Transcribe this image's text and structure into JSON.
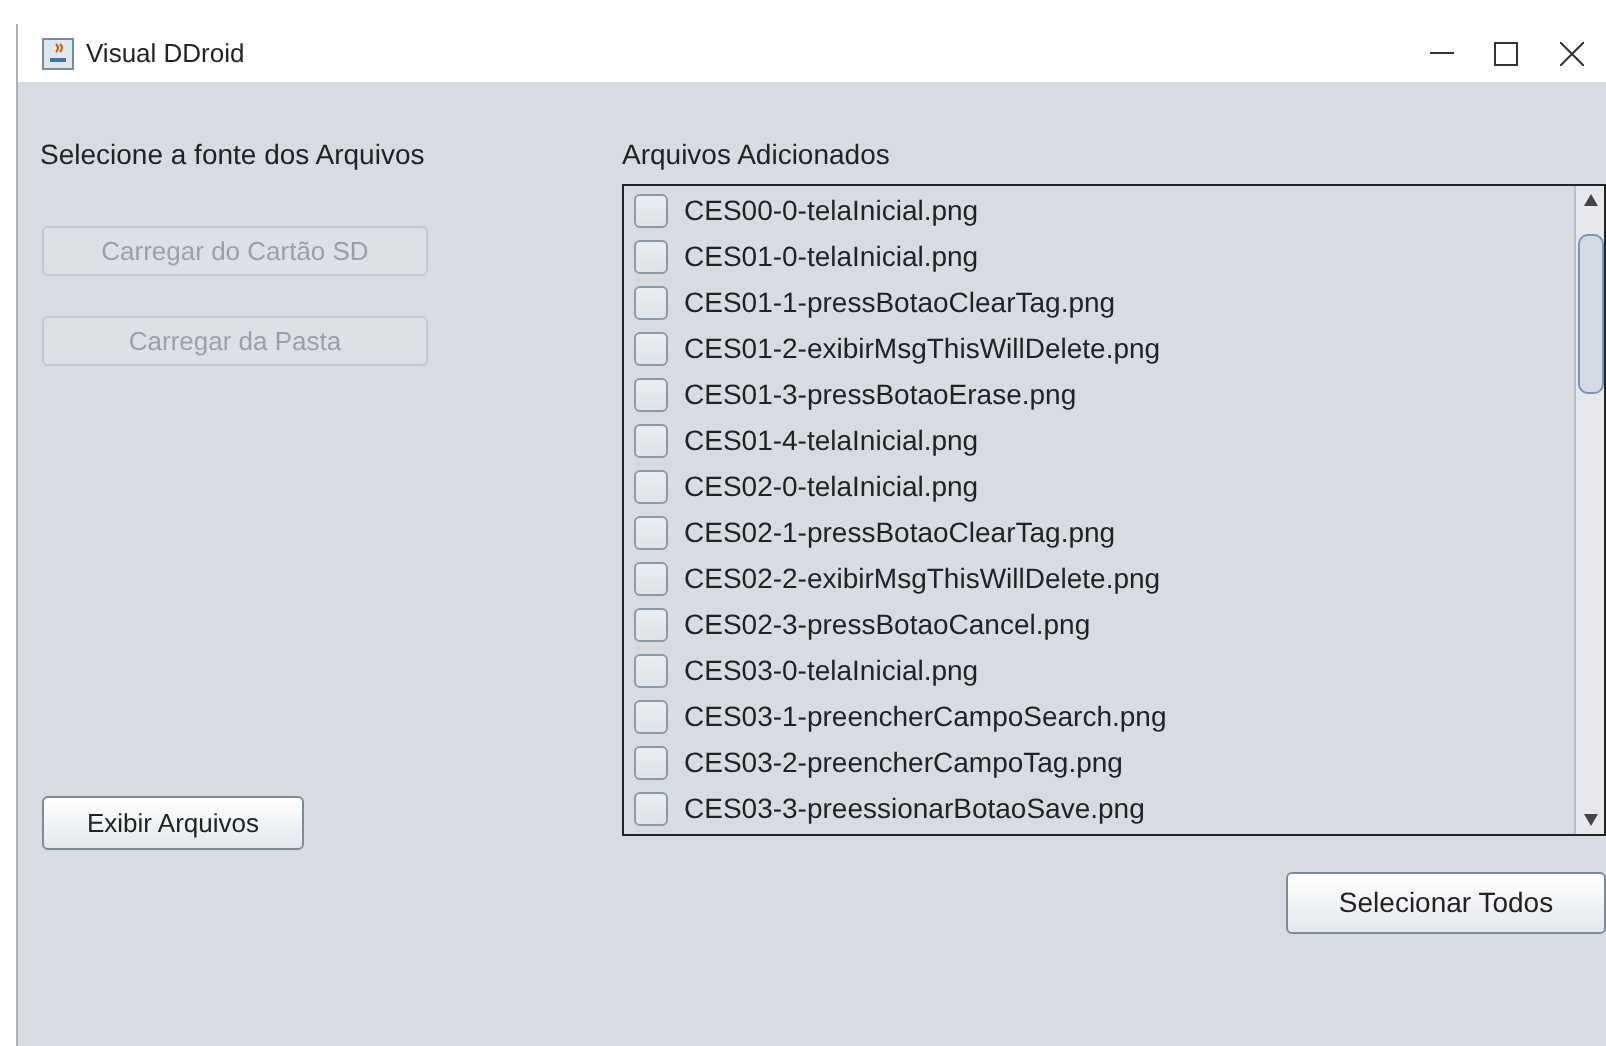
{
  "window": {
    "title": "Visual DDroid"
  },
  "source_panel": {
    "label": "Selecione a fonte dos Arquivos",
    "buttons": [
      {
        "label": "Carregar do Cartão SD",
        "disabled": true
      },
      {
        "label": "Carregar da Pasta",
        "disabled": true
      }
    ],
    "show_button": {
      "label": "Exibir Arquivos",
      "disabled": false
    }
  },
  "files_panel": {
    "label": "Arquivos Adicionados",
    "files": [
      {
        "name": "CES00-0-telaInicial.png",
        "checked": false
      },
      {
        "name": "CES01-0-telaInicial.png",
        "checked": false
      },
      {
        "name": "CES01-1-pressBotaoClearTag.png",
        "checked": false
      },
      {
        "name": "CES01-2-exibirMsgThisWillDelete.png",
        "checked": false
      },
      {
        "name": "CES01-3-pressBotaoErase.png",
        "checked": false
      },
      {
        "name": "CES01-4-telaInicial.png",
        "checked": false
      },
      {
        "name": "CES02-0-telaInicial.png",
        "checked": false
      },
      {
        "name": "CES02-1-pressBotaoClearTag.png",
        "checked": false
      },
      {
        "name": "CES02-2-exibirMsgThisWillDelete.png",
        "checked": false
      },
      {
        "name": "CES02-3-pressBotaoCancel.png",
        "checked": false
      },
      {
        "name": "CES03-0-telaInicial.png",
        "checked": false
      },
      {
        "name": "CES03-1-preencherCampoSearch.png",
        "checked": false
      },
      {
        "name": "CES03-2-preencherCampoTag.png",
        "checked": false
      },
      {
        "name": "CES03-3-preessionarBotaoSave.png",
        "checked": false
      }
    ],
    "select_all_button": {
      "label": "Selecionar Todos"
    }
  }
}
